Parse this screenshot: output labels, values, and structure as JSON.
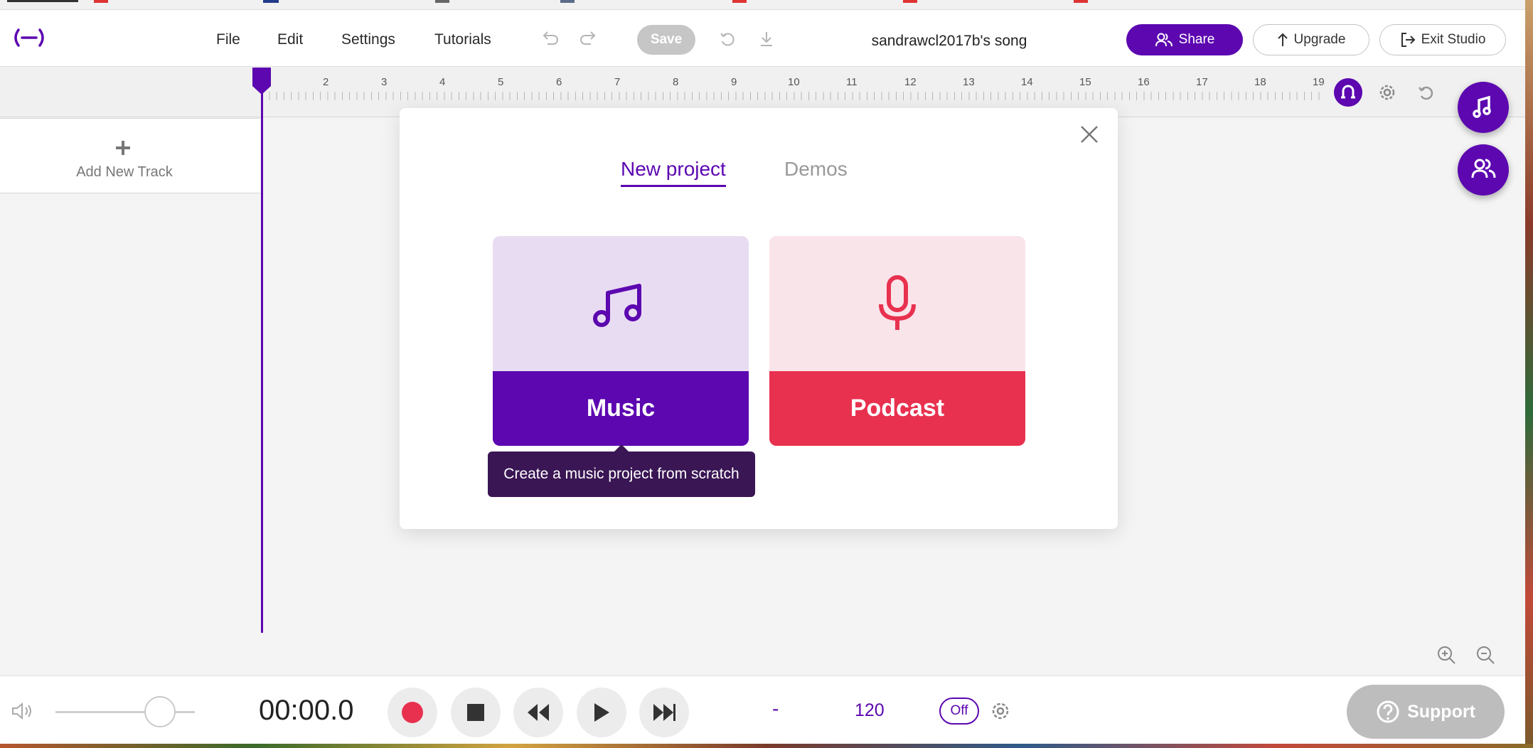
{
  "menu": {
    "file": "File",
    "edit": "Edit",
    "settings": "Settings",
    "tutorials": "Tutorials"
  },
  "toolbar": {
    "save_label": "Save"
  },
  "project_title": "sandrawcl2017b's song",
  "actions": {
    "share": "Share",
    "upgrade": "Upgrade",
    "exit": "Exit Studio"
  },
  "ruler": {
    "ticks": [
      "2",
      "3",
      "4",
      "5",
      "6",
      "7",
      "8",
      "9",
      "10",
      "11",
      "12",
      "13",
      "14",
      "15",
      "16",
      "17",
      "18",
      "19"
    ]
  },
  "tracks": {
    "add_label": "Add New Track"
  },
  "modal": {
    "tabs": {
      "new_project": "New project",
      "demos": "Demos"
    },
    "cards": {
      "music": "Music",
      "podcast": "Podcast"
    },
    "tooltip": "Create a music project from scratch"
  },
  "transport": {
    "time": "00:00.0",
    "tempo_dash": "-",
    "bpm": "120",
    "metronome": "Off",
    "volume_level": 0.75
  },
  "support": "Support",
  "colors": {
    "accent": "#5c07b0",
    "podcast": "#e8314f",
    "music_light": "#e8dcf2",
    "podcast_light": "#f9e4ea"
  }
}
